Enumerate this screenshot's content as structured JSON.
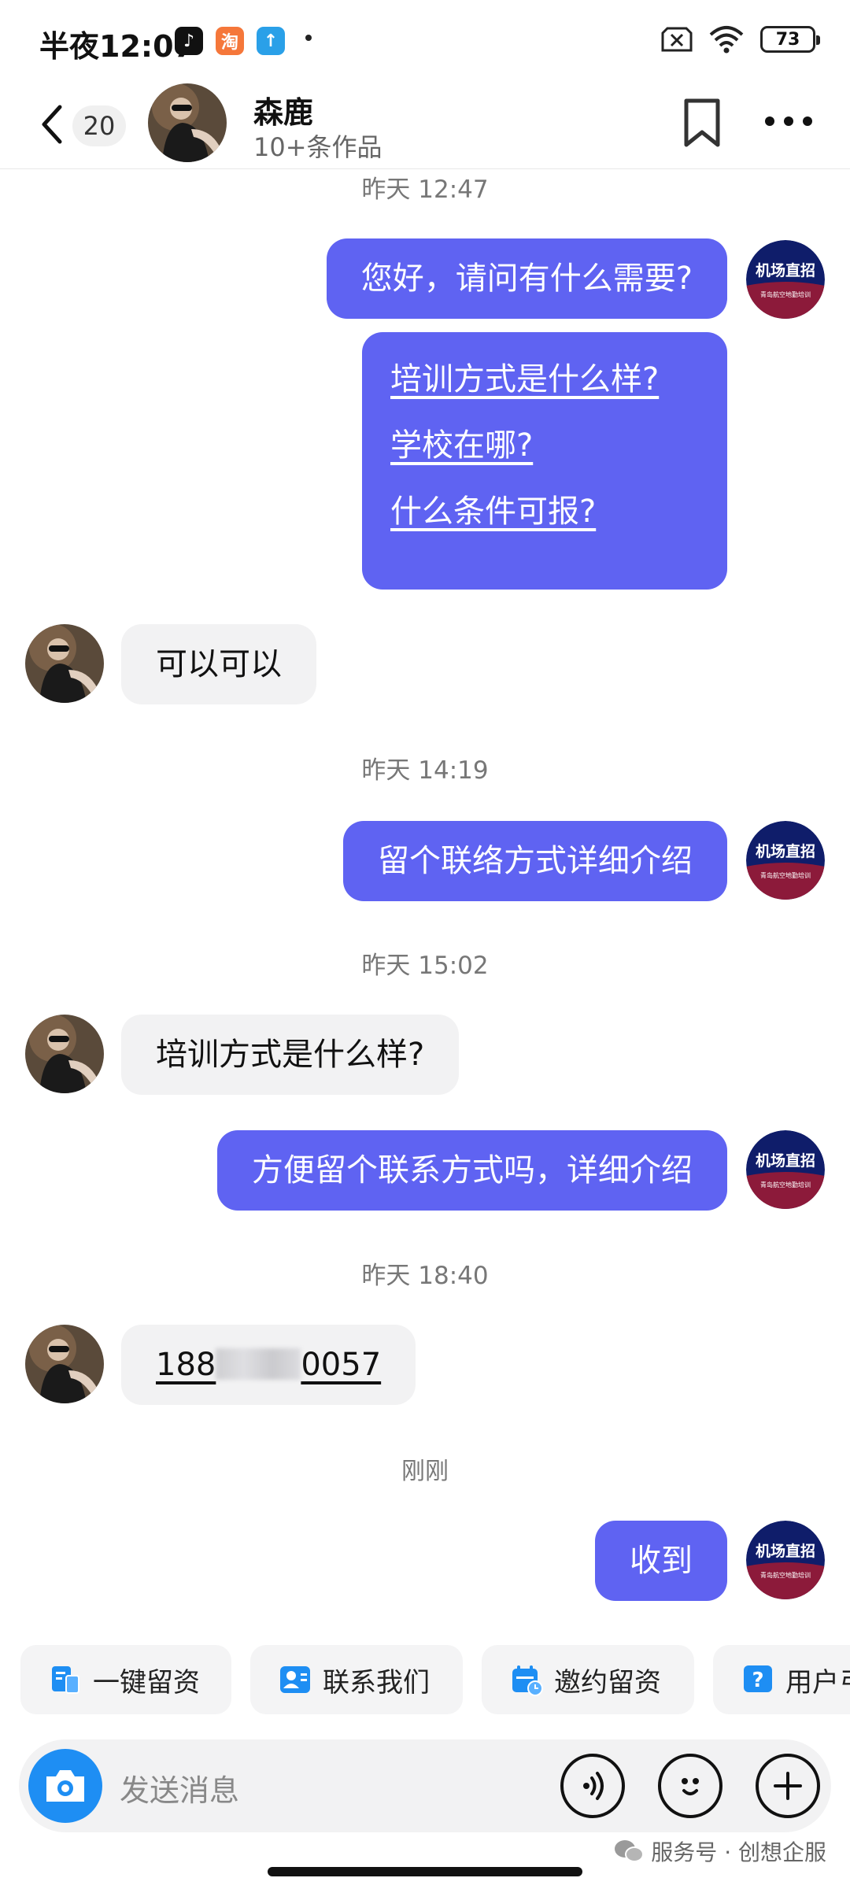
{
  "status_bar": {
    "time": "半夜12:07",
    "battery": "73",
    "icons": [
      "tiktok-icon",
      "taobao-icon",
      "upload-icon",
      "sim-off-icon",
      "wifi-icon",
      "battery-icon"
    ]
  },
  "header": {
    "unread_count": "20",
    "contact_name": "森鹿",
    "contact_subtitle": "10+条作品"
  },
  "brand_avatar": {
    "title": "机场直招",
    "subtitle": "青岛航空地勤培训",
    "colors": {
      "top": "#0f1d6a",
      "bottom": "#8c1a3a"
    }
  },
  "messages": [
    {
      "type": "timestamp",
      "text": "昨天 12:47"
    },
    {
      "type": "outgoing",
      "text": "您好，请问有什么需要?"
    },
    {
      "type": "outgoing_menu",
      "items": [
        "培训方式是什么样?",
        "学校在哪?",
        "什么条件可报?"
      ]
    },
    {
      "type": "incoming",
      "text": "可以可以"
    },
    {
      "type": "timestamp",
      "text": "昨天 14:19"
    },
    {
      "type": "outgoing",
      "text": "留个联络方式详细介绍"
    },
    {
      "type": "timestamp",
      "text": "昨天 15:02"
    },
    {
      "type": "incoming",
      "text": "培训方式是什么样?"
    },
    {
      "type": "outgoing",
      "text": "方便留个联系方式吗，详细介绍"
    },
    {
      "type": "timestamp",
      "text": "昨天 18:40"
    },
    {
      "type": "incoming_phone",
      "prefix": "188",
      "suffix": "0057"
    },
    {
      "type": "timestamp",
      "text": "刚刚"
    },
    {
      "type": "outgoing",
      "text": "收到"
    }
  ],
  "quick_actions": [
    {
      "label": "一键留资",
      "icon": "form-icon"
    },
    {
      "label": "联系我们",
      "icon": "contacts-icon"
    },
    {
      "label": "邀约留资",
      "icon": "calendar-icon"
    },
    {
      "label": "用户弓",
      "icon": "question-icon"
    }
  ],
  "input": {
    "placeholder": "发送消息"
  },
  "watermark": "服务号 · 创想企服",
  "colors": {
    "outgoing_bubble": "#5f63f2",
    "incoming_bubble": "#f2f2f3",
    "camera_button": "#1e8ef3"
  }
}
